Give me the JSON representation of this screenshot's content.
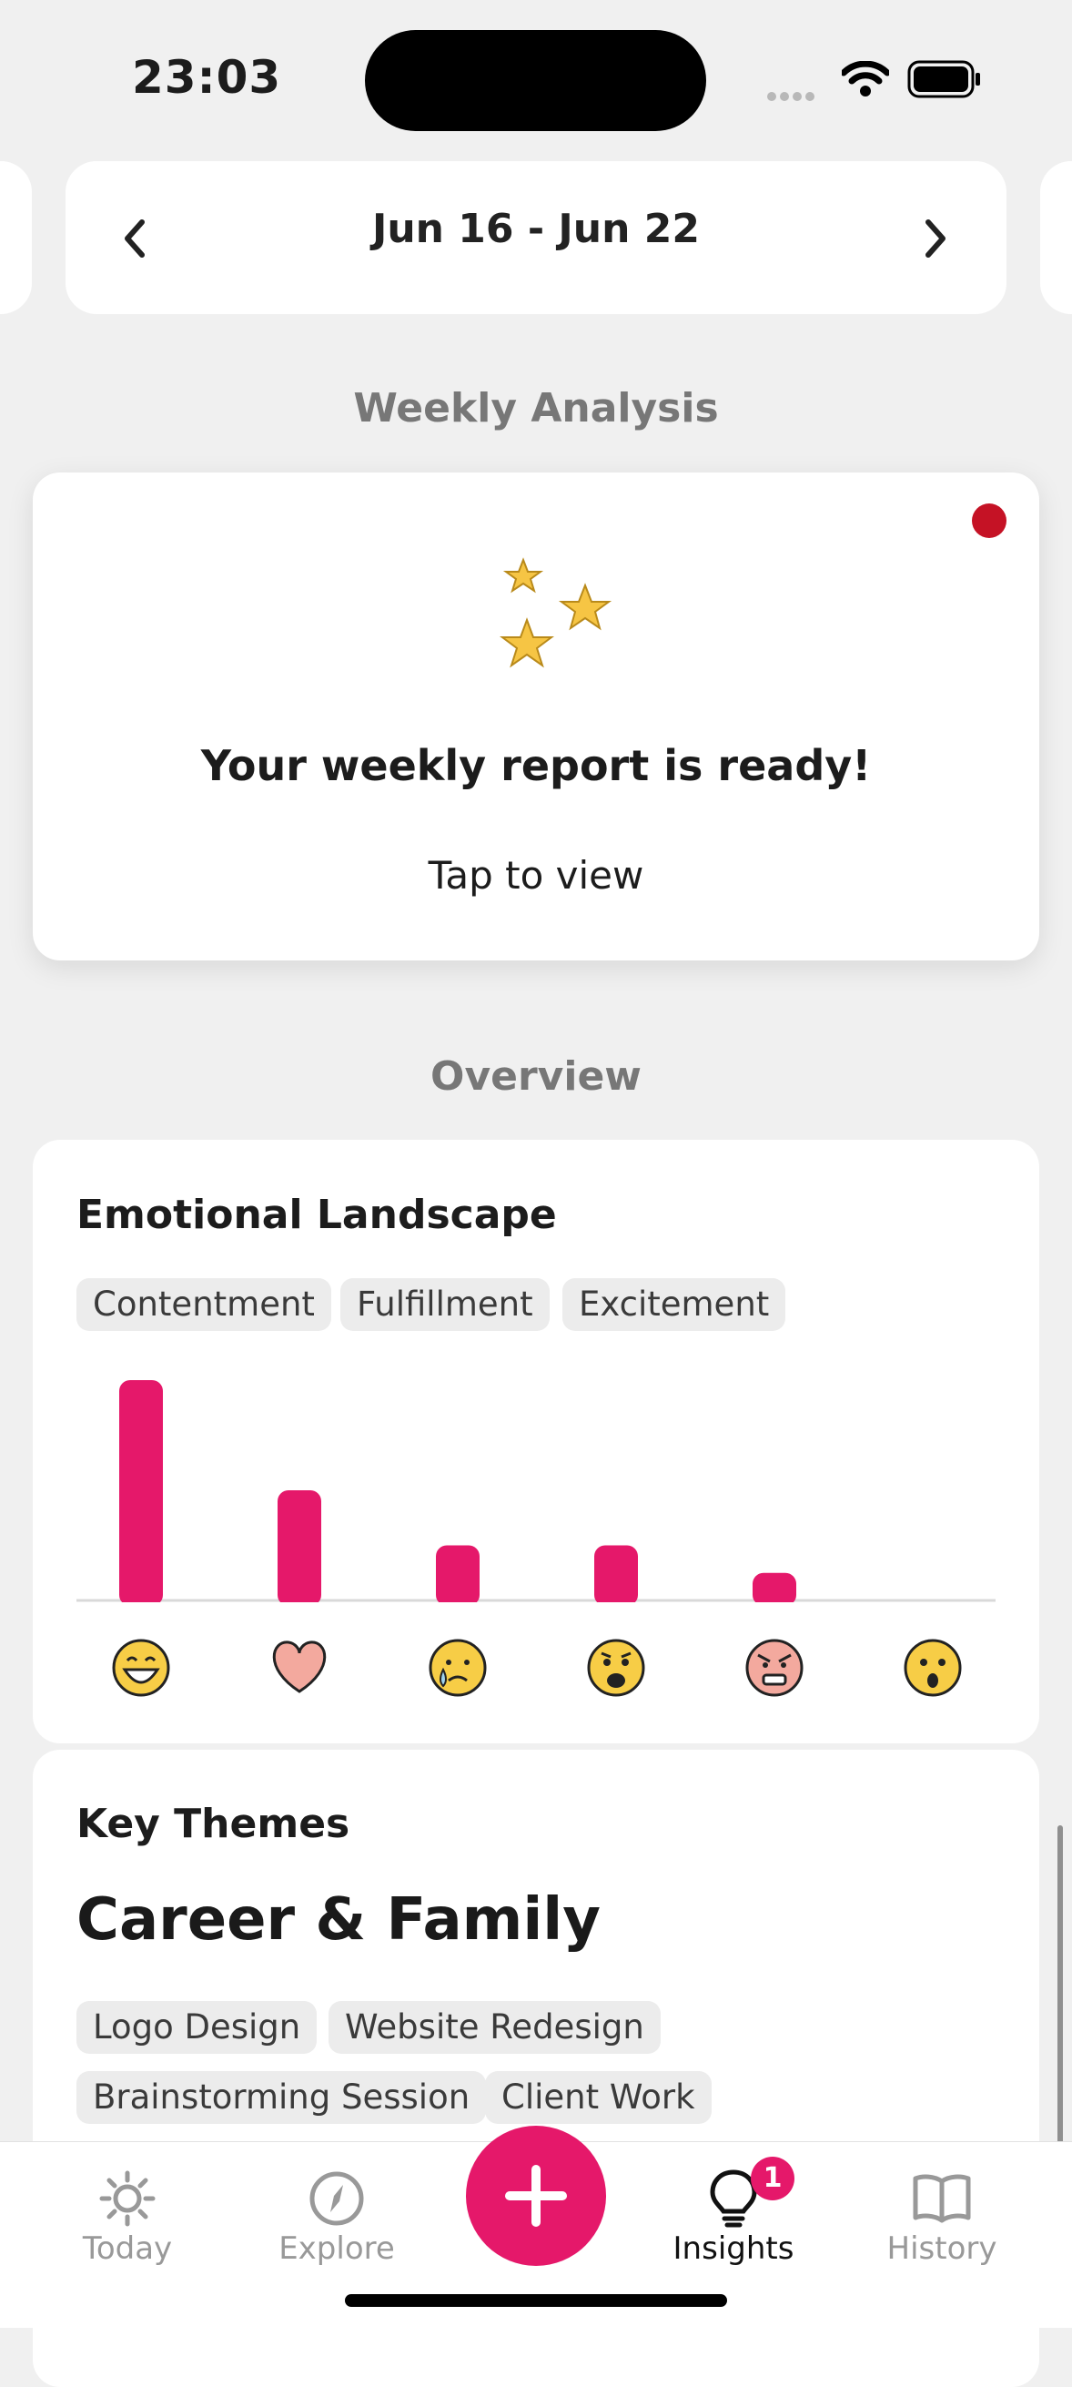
{
  "status_bar": {
    "time": "23:03"
  },
  "week_selector": {
    "label": "Jun 16 - Jun 22"
  },
  "weekly_analysis": {
    "section_title": "Weekly Analysis",
    "report_title": "Your weekly report is ready!",
    "report_subtitle": "Tap to view"
  },
  "overview": {
    "section_title": "Overview",
    "emotional_landscape": {
      "title": "Emotional Landscape",
      "tags": [
        "Contentment",
        "Fulfillment",
        "Excitement"
      ]
    },
    "key_themes": {
      "title": "Key Themes",
      "headline": "Career & Family",
      "tags": [
        "Logo Design",
        "Website Redesign",
        "Brainstorming Session",
        "Client Work"
      ]
    }
  },
  "chart_data": {
    "type": "bar",
    "categories": [
      "grinning-face",
      "heart",
      "crying-face",
      "anguished-face",
      "angry-face",
      "astonished-face"
    ],
    "values": [
      8,
      4,
      2,
      2,
      1,
      0
    ],
    "ylim": [
      0,
      8
    ],
    "bar_color": "#e5186a",
    "grid": false
  },
  "tab_bar": {
    "tabs": [
      {
        "label": "Today",
        "icon": "sun-icon",
        "active": false
      },
      {
        "label": "Explore",
        "icon": "compass-icon",
        "active": false
      },
      {
        "label": "Insights",
        "icon": "lightbulb-icon",
        "active": true,
        "badge": "1"
      },
      {
        "label": "History",
        "icon": "book-icon",
        "active": false
      }
    ],
    "add_icon": "plus-icon"
  },
  "colors": {
    "accent": "#e5186a",
    "notification_dot": "#c51225",
    "background": "#f0f0f0"
  }
}
